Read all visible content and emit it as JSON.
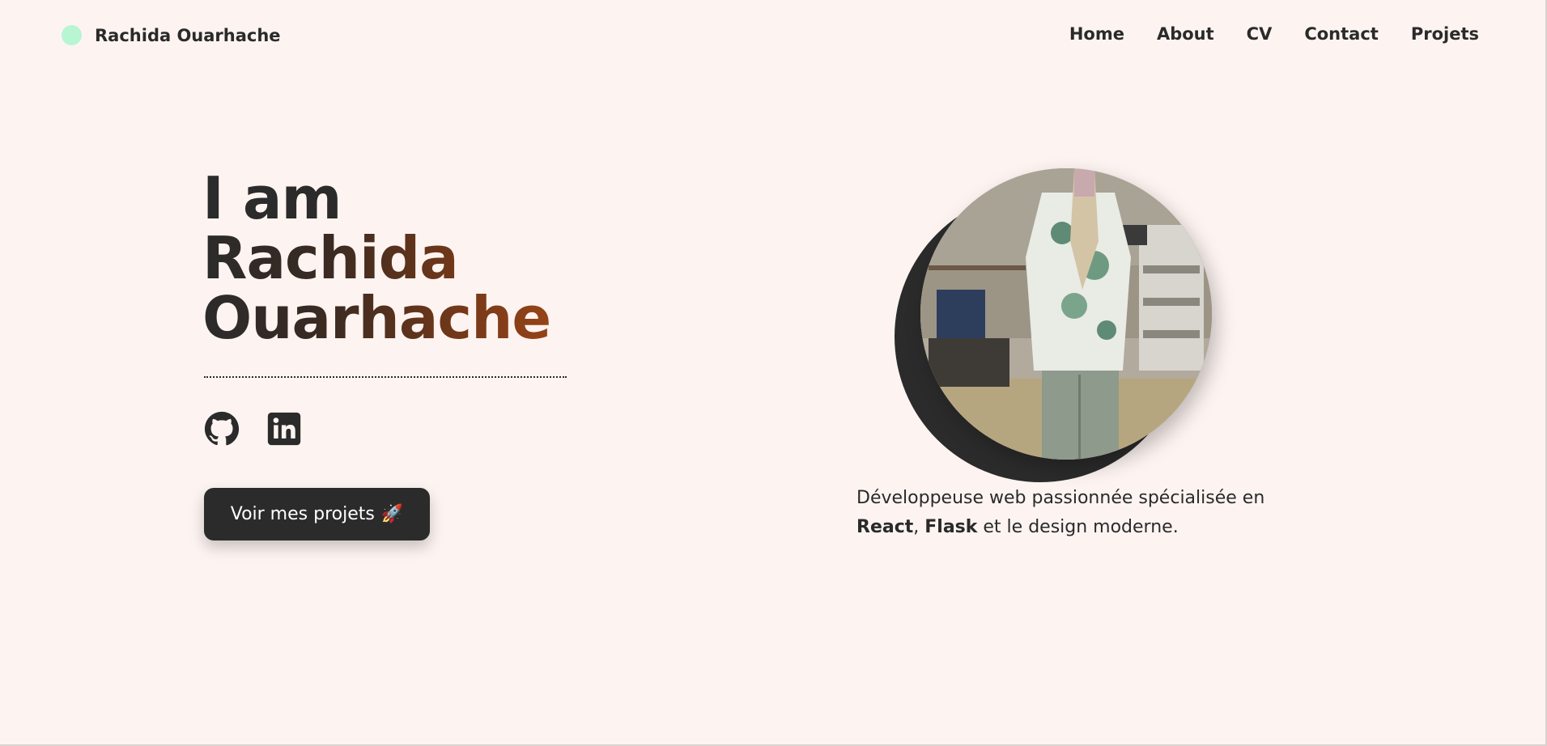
{
  "header": {
    "brand_name": "Rachida Ouarhache",
    "nav": [
      "Home",
      "About",
      "CV",
      "Contact",
      "Projets"
    ]
  },
  "hero": {
    "title_intro": "I am",
    "title_first_name": "Rachida",
    "title_last_name": "Ouarhache",
    "social_icons": [
      "github-icon",
      "linkedin-icon"
    ],
    "cta_label": "Voir mes projets",
    "cta_emoji": "🚀",
    "tagline_before": "Développeuse web passionnée spécialisée en ",
    "tagline_tech_1": "React",
    "tagline_sep": ", ",
    "tagline_tech_2": "Flask",
    "tagline_after": " et le design moderne."
  },
  "colors": {
    "background": "#fdf4f1",
    "dark": "#2b2b2b",
    "accent_gradient_end": "#b24c16",
    "brand_dot": "#b7f5d3"
  }
}
